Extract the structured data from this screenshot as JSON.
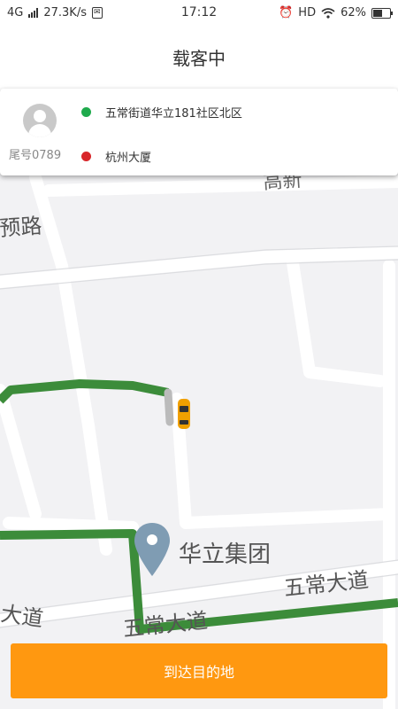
{
  "status_bar": {
    "network": "4G",
    "speed": "27.3K/s",
    "time": "17:12",
    "hd": "HD",
    "battery": "62%",
    "battery_level": 0.62
  },
  "header": {
    "title": "载客中"
  },
  "trip": {
    "passenger_tail": "尾号0789",
    "start": "五常街道华立181社区北区",
    "end": "杭州大厦"
  },
  "map": {
    "labels": {
      "road_left": "预路",
      "road_top": "高新",
      "poi": "华立集团",
      "road_wuchang_right": "五常大道",
      "road_wuchang_bottom": "五常大道",
      "road_left_bottom": "大道"
    },
    "route_color": "#3c8c3a",
    "pin_color": "#7f9cb3",
    "car_color": "#f0a000"
  },
  "action": {
    "arrive_label": "到达目的地"
  },
  "colors": {
    "accent": "#ff9810",
    "start_dot": "#1faa4c",
    "end_dot": "#d8262a"
  }
}
